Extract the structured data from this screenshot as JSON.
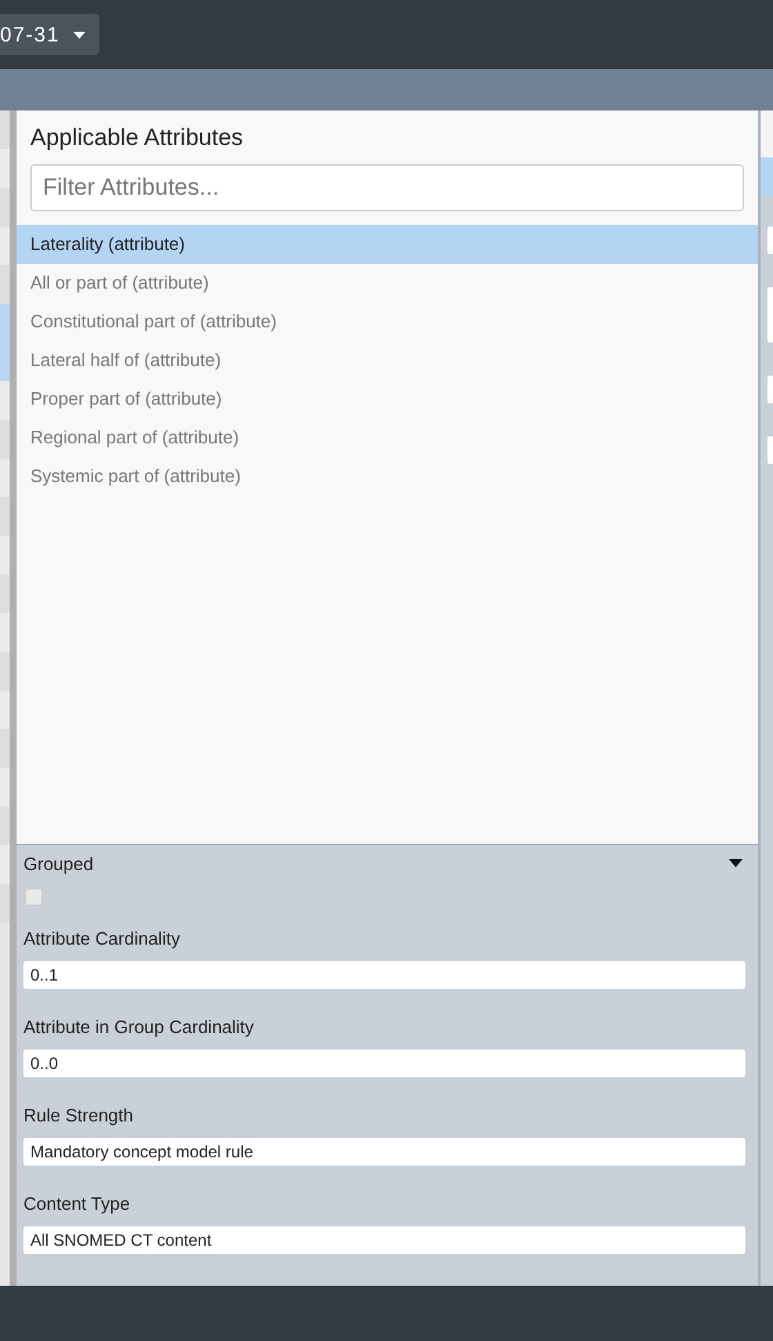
{
  "top_bar": {
    "release_dropdown": {
      "value": "07-31"
    }
  },
  "attributes_panel": {
    "title": "Applicable Attributes",
    "filter": {
      "placeholder": "Filter Attributes..."
    },
    "items": [
      {
        "label": "Laterality (attribute)",
        "selected": true
      },
      {
        "label": "All or part of (attribute)",
        "selected": false
      },
      {
        "label": "Constitutional part of (attribute)",
        "selected": false
      },
      {
        "label": "Lateral half of (attribute)",
        "selected": false
      },
      {
        "label": "Proper part of (attribute)",
        "selected": false
      },
      {
        "label": "Regional part of (attribute)",
        "selected": false
      },
      {
        "label": "Systemic part of (attribute)",
        "selected": false
      }
    ]
  },
  "rule_form": {
    "grouped": {
      "label": "Grouped",
      "checked": false
    },
    "fields": [
      {
        "label": "Attribute Cardinality",
        "value": "0..1"
      },
      {
        "label": "Attribute in Group Cardinality",
        "value": "0..0"
      },
      {
        "label": "Rule Strength",
        "value": "Mandatory concept model rule"
      },
      {
        "label": "Content Type",
        "value": "All SNOMED CT content"
      }
    ]
  }
}
